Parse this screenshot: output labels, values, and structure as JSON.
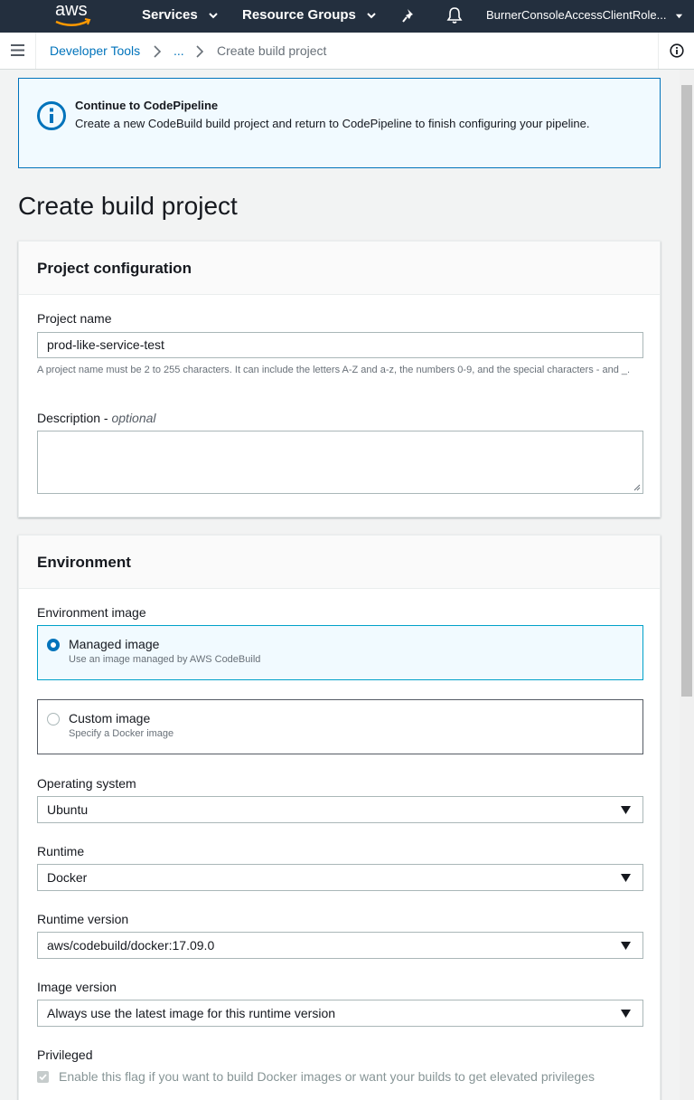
{
  "topnav": {
    "logo": "aws",
    "services": "Services",
    "resource_groups": "Resource Groups",
    "account": "BurnerConsoleAccessClientRole..."
  },
  "breadcrumb": {
    "items": [
      "Developer Tools",
      "...",
      "Create build project"
    ]
  },
  "flash": {
    "title": "Continue to CodePipeline",
    "message": "Create a new CodeBuild build project and return to CodePipeline to finish configuring your pipeline."
  },
  "page_title": "Create build project",
  "project_config": {
    "heading": "Project configuration",
    "name_label": "Project name",
    "name_value": "prod-like-service-test",
    "name_hint": "A project name must be 2 to 255 characters. It can include the letters A-Z and a-z, the numbers 0-9, and the special characters - and _.",
    "desc_label": "Description",
    "desc_optional": "optional",
    "desc_value": ""
  },
  "environment": {
    "heading": "Environment",
    "image_label": "Environment image",
    "managed_title": "Managed image",
    "managed_sub": "Use an image managed by AWS CodeBuild",
    "custom_title": "Custom image",
    "custom_sub": "Specify a Docker image",
    "os_label": "Operating system",
    "os_value": "Ubuntu",
    "runtime_label": "Runtime",
    "runtime_value": "Docker",
    "runtime_version_label": "Runtime version",
    "runtime_version_value": "aws/codebuild/docker:17.09.0",
    "image_version_label": "Image version",
    "image_version_value": "Always use the latest image for this runtime version",
    "privileged_label": "Privileged",
    "privileged_text": "Enable this flag if you want to build Docker images or want your builds to get elevated privileges"
  },
  "colors": {
    "nav": "#232f3e",
    "link": "#0073bb",
    "accent": "#ff9900"
  }
}
